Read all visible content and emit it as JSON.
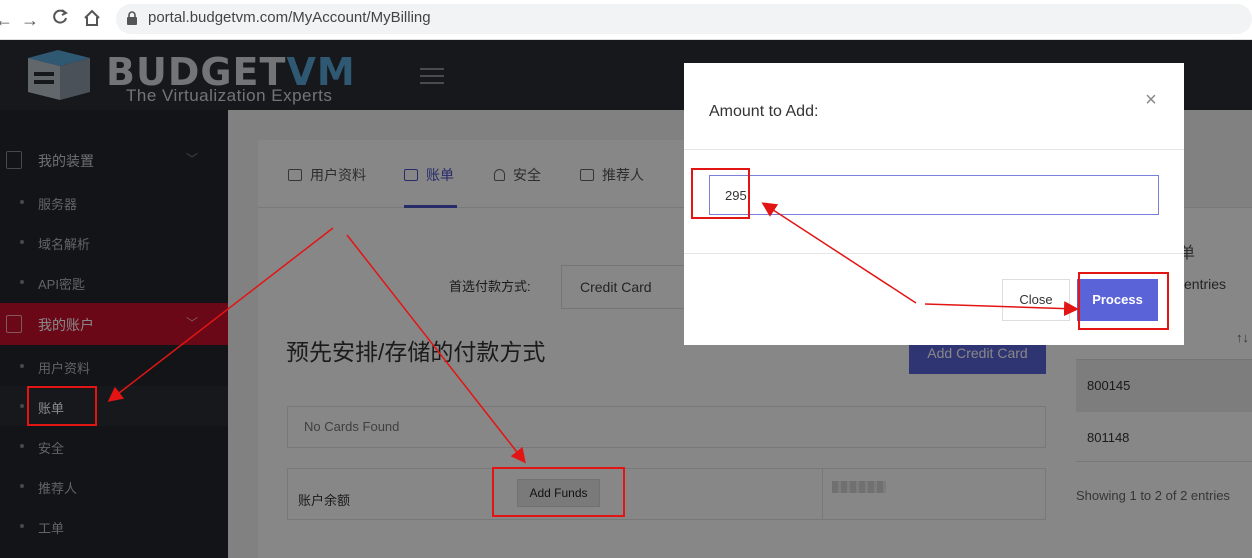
{
  "browser": {
    "url": "portal.budgetvm.com/MyAccount/MyBilling",
    "back_icon": "arrow-left-icon",
    "forward_icon": "arrow-right-icon",
    "reload_icon": "reload-icon",
    "home_icon": "home-icon",
    "lock_icon": "lock-icon"
  },
  "header": {
    "logo_main": "BUDGET",
    "logo_accent": "VM",
    "logo_sub": "The Virtualization Experts"
  },
  "sidebar": {
    "groups": [
      {
        "label": "我的装置",
        "items": [
          "服务器",
          "域名解析",
          "API密匙"
        ]
      },
      {
        "label": "我的账户",
        "items": [
          "用户资料",
          "账单",
          "安全",
          "推荐人",
          "工单"
        ]
      }
    ]
  },
  "tabs": [
    "用户资料",
    "账单",
    "安全",
    "推荐人"
  ],
  "billing": {
    "pref_label": "首选付款方式:",
    "pref_value": "Credit Card",
    "section_title": "预先安排/存储的付款方式",
    "add_card_label": "Add Credit Card",
    "no_cards": "No Cards Found",
    "balance_label": "账户余额",
    "add_funds_label": "Add Funds"
  },
  "right_panel": {
    "title_fragment": "单",
    "entries_label": "entries",
    "sort_icon": "↑↓",
    "rows": [
      "800145",
      "801148"
    ],
    "showing": "Showing 1 to 2 of 2 entries"
  },
  "modal": {
    "title": "Amount to Add:",
    "amount_value": "295",
    "close_label": "Close",
    "process_label": "Process",
    "close_x": "×"
  },
  "colors": {
    "accent": "#5a63d8",
    "sidebar_active": "#c8102e",
    "annotation": "#e31414"
  }
}
